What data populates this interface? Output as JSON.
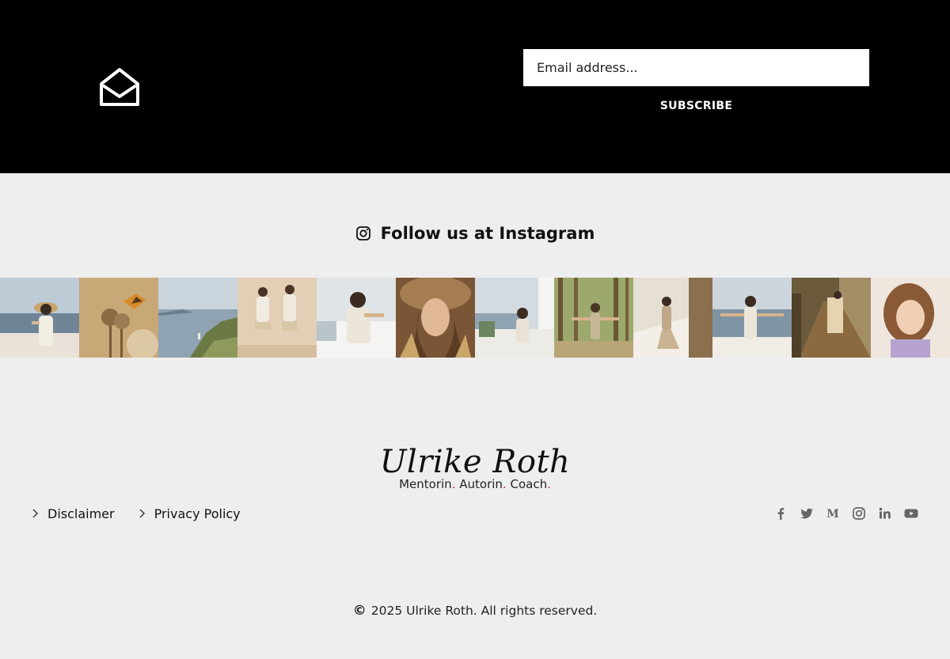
{
  "newsletter": {
    "icon": "envelope-open-icon",
    "email_placeholder": "Email address...",
    "subscribe_label": "SUBSCRIBE"
  },
  "instagram": {
    "icon": "instagram-icon",
    "heading": "Follow us at Instagram",
    "photos": [
      "woman-with-straw-hat-seaside",
      "butterfly-on-dried-flower",
      "coastal-cliffs",
      "two-women-jumping",
      "woman-on-terrace-white-village",
      "woman-portrait-with-wheat",
      "woman-sitting-white-village",
      "woman-in-forest-arms-open",
      "woman-dancing-on-wall",
      "woman-on-terrace-sea",
      "woman-on-wooden-boardwalk",
      "smiling-girl-with-book"
    ]
  },
  "logo": {
    "name": "Ulrike Roth",
    "tagline": [
      "Mentorin",
      "Autorin",
      "Coach"
    ],
    "accent": "#c0392b"
  },
  "footer": {
    "links": [
      {
        "label": "Disclaimer"
      },
      {
        "label": "Privacy Policy"
      }
    ],
    "social": [
      "facebook-icon",
      "twitter-icon",
      "medium-icon",
      "instagram-icon",
      "linkedin-icon",
      "youtube-icon"
    ],
    "copyright_symbol": "©",
    "copyright_text": "2025 Ulrike Roth. All rights reserved."
  }
}
